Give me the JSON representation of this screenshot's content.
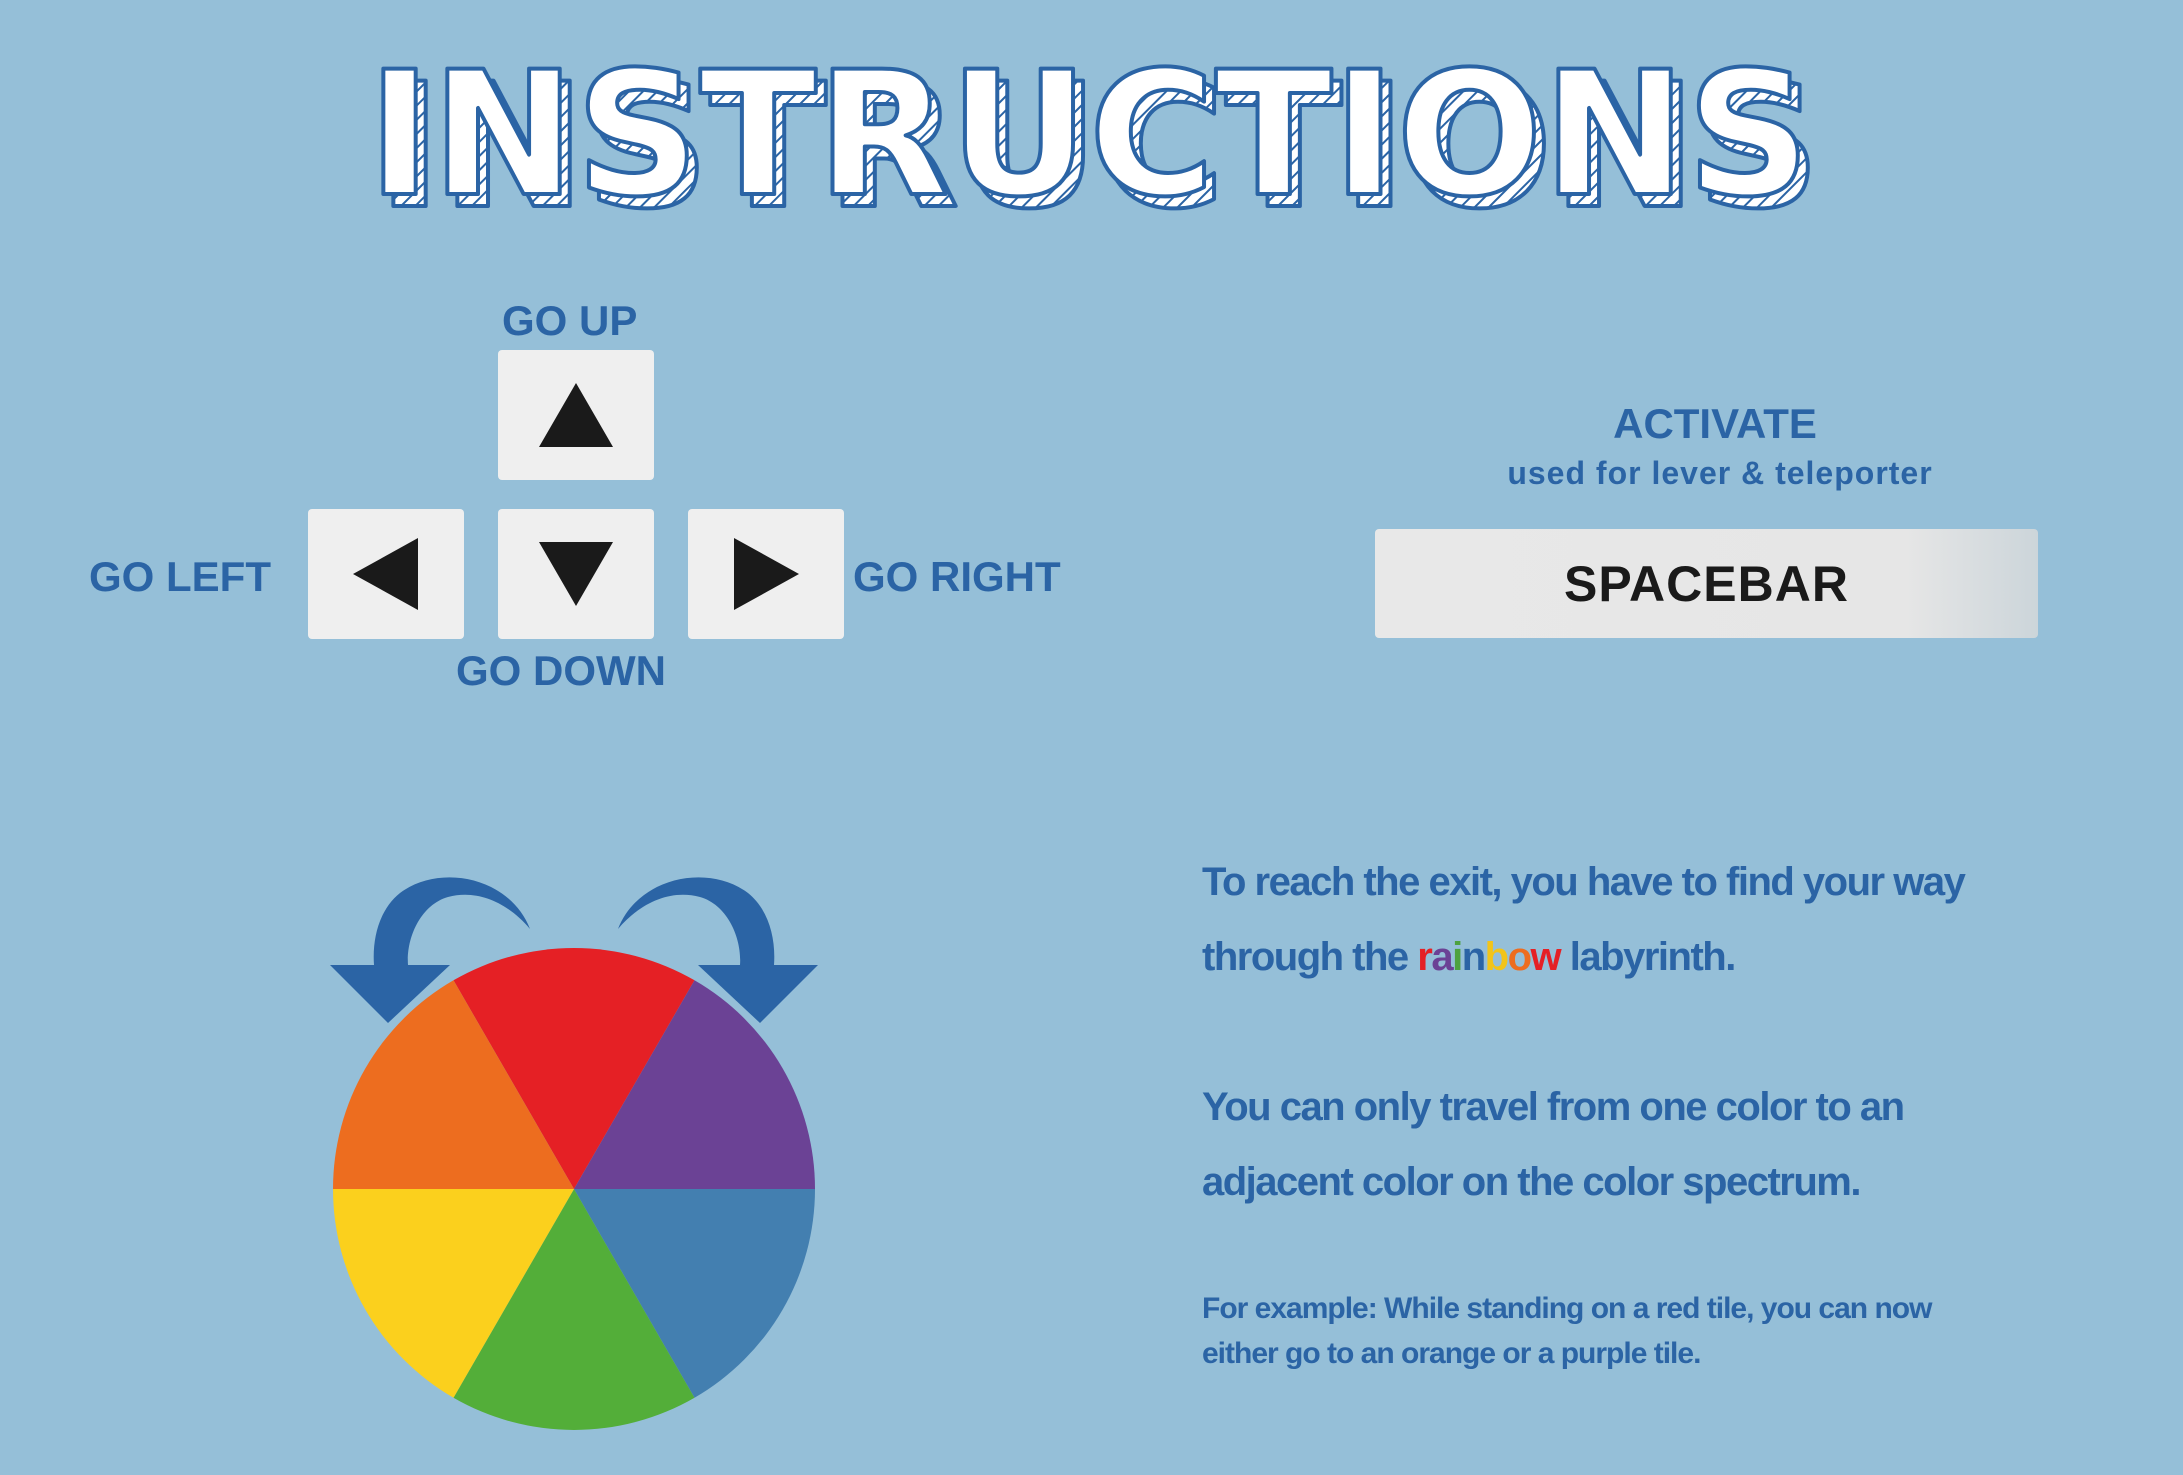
{
  "title": "INSTRUCTIONS",
  "controls": {
    "up_label": "GO UP",
    "down_label": "GO DOWN",
    "left_label": "GO LEFT",
    "right_label": "GO RIGHT",
    "up_icon": "arrow-up-icon",
    "down_icon": "arrow-down-icon",
    "left_icon": "arrow-left-icon",
    "right_icon": "arrow-right-icon"
  },
  "activate": {
    "title": "ACTIVATE",
    "subtitle": "used for lever & teleporter",
    "key_label": "SPACEBAR"
  },
  "description": {
    "line1": "To reach the exit, you have to find your way",
    "line2_before": "through the ",
    "rainbow_letters": [
      "r",
      "a",
      "i",
      "n",
      "b",
      "o",
      "w"
    ],
    "rainbow_colors": [
      "#e52025",
      "#6b4295",
      "#4da23f",
      "#2b64a5",
      "#f2c419",
      "#ed6d1f",
      "#e52025"
    ],
    "line2_after": " labyrinth.",
    "para2_line1": "You can only travel from one color to an",
    "para2_line2": "adjacent color on the color spectrum.",
    "example_line1": "For example: While standing on a red tile, you can now",
    "example_line2": "either go to an orange or a purple tile."
  },
  "color_wheel": {
    "slices": [
      {
        "color": "#e52025",
        "name": "red"
      },
      {
        "color": "#6b4295",
        "name": "purple"
      },
      {
        "color": "#437fb0",
        "name": "blue"
      },
      {
        "color": "#53ae39",
        "name": "green"
      },
      {
        "color": "#fbd01d",
        "name": "yellow"
      },
      {
        "color": "#ed6d1f",
        "name": "orange"
      }
    ],
    "arrow_color": "#2b64a5"
  },
  "colors": {
    "background": "#95bfd8",
    "text_blue": "#2b64a5",
    "key_bg": "#efefef"
  }
}
